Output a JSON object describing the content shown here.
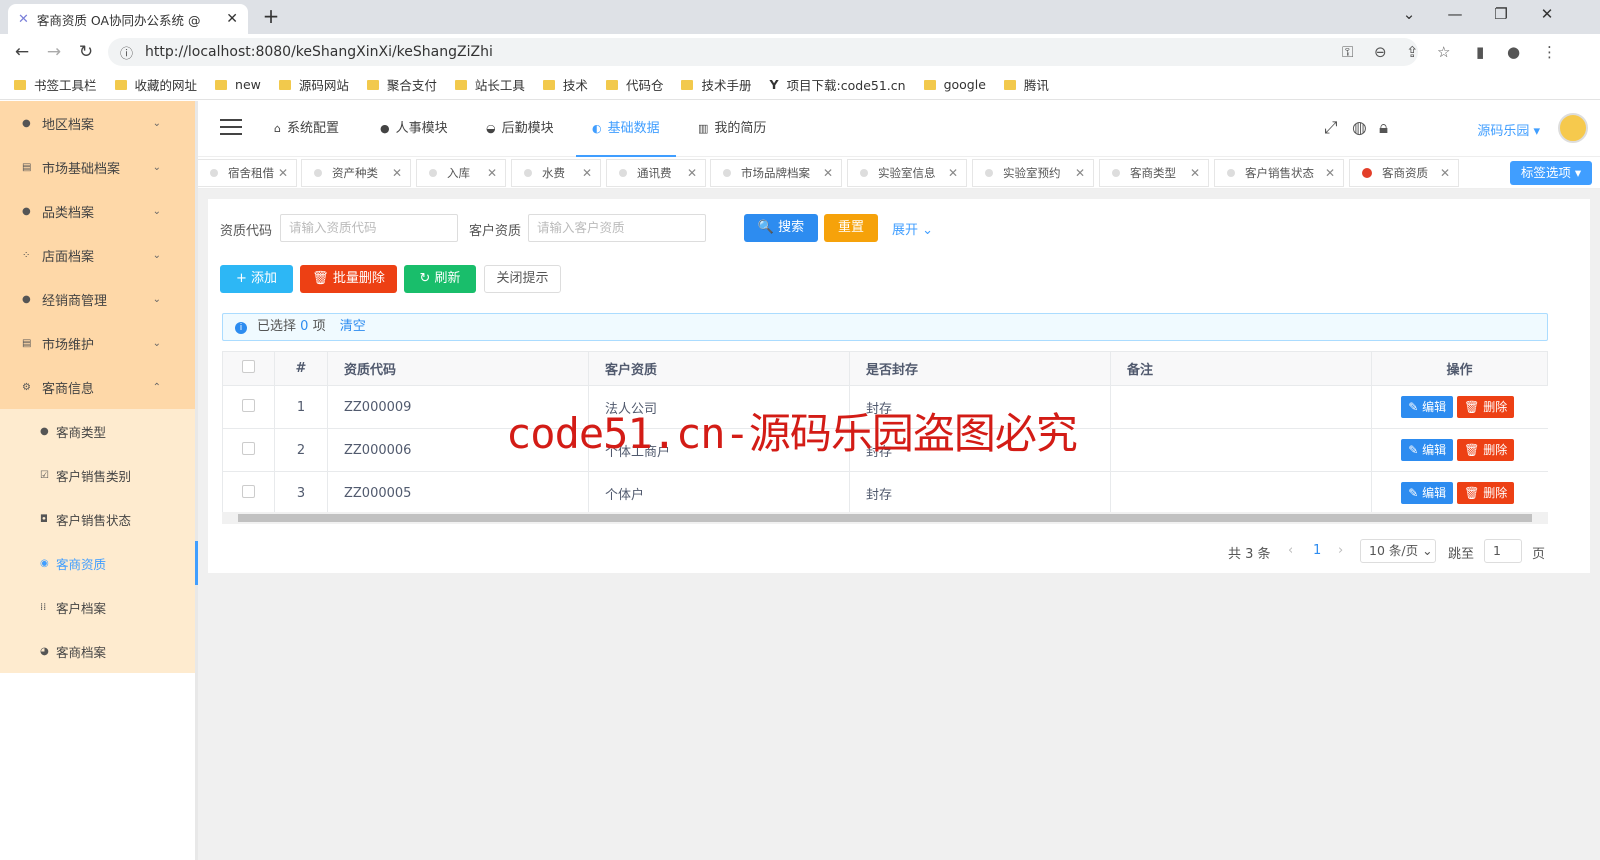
{
  "browser": {
    "tab_title": "客商资质 OA协同办公系统 @",
    "tab_close": "✕",
    "new_tab": "+",
    "url": "http://localhost:8080/keShangXinXi/keShangZiZhi",
    "bookmarks": [
      "书签工具栏",
      "收藏的网址",
      "new",
      "源码网站",
      "聚合支付",
      "站长工具",
      "技术",
      "代码仓",
      "技术手册",
      "项目下载:code51.cn",
      "google",
      "腾讯"
    ]
  },
  "sidebar": {
    "groups": [
      {
        "label": "地区档案",
        "icon": "circle-icon"
      },
      {
        "label": "市场基础档案",
        "icon": "table-icon"
      },
      {
        "label": "品类档案",
        "icon": "circle-icon"
      },
      {
        "label": "店面档案",
        "icon": "grid-icon"
      },
      {
        "label": "经销商管理",
        "icon": "circle-icon"
      },
      {
        "label": "市场维护",
        "icon": "table-icon"
      },
      {
        "label": "客商信息",
        "icon": "gear-icon"
      }
    ],
    "sub_items": [
      {
        "label": "客商类型"
      },
      {
        "label": "客户销售类别"
      },
      {
        "label": "客户销售状态"
      },
      {
        "label": "客商资质"
      },
      {
        "label": "客户档案"
      },
      {
        "label": "客商档案"
      }
    ]
  },
  "topnav": {
    "items": [
      "系统配置",
      "人事模块",
      "后勤模块",
      "基础数据",
      "我的简历"
    ],
    "active": "基础数据",
    "user": "源码乐园 ▾"
  },
  "page_tabs": [
    "宿舍租借",
    "资产种类",
    "入库",
    "水费",
    "通讯费",
    "市场品牌档案",
    "实验室信息",
    "实验室预约",
    "客商类型",
    "客户销售状态",
    "客商资质"
  ],
  "tag_options": "标签选项 ▾",
  "search": {
    "code_label": "资质代码",
    "code_placeholder": "请输入资质代码",
    "qual_label": "客户资质",
    "qual_placeholder": "请输入客户资质",
    "search_btn": "🔍 搜索",
    "reset_btn": "重置",
    "expand": "展开 ⌄"
  },
  "toolbar": {
    "add": "+ 添加",
    "batch_delete": "批量删除",
    "refresh": "刷新",
    "close_tip": "关闭提示"
  },
  "alert": {
    "prefix": "已选择",
    "count": "0",
    "suffix": "项",
    "clear": "清空"
  },
  "table": {
    "headers": [
      "#",
      "资质代码",
      "客户资质",
      "是否封存",
      "备注",
      "操作"
    ],
    "rows": [
      {
        "no": "1",
        "code": "ZZ000009",
        "qual": "法人公司",
        "sealed": "封存",
        "note": ""
      },
      {
        "no": "2",
        "code": "ZZ000006",
        "qual": "个体工商户",
        "sealed": "封存",
        "note": ""
      },
      {
        "no": "3",
        "code": "ZZ000005",
        "qual": "个体户",
        "sealed": "封存",
        "note": ""
      }
    ],
    "edit": "编辑",
    "delete": "删除"
  },
  "pagination": {
    "total": "共 3 条",
    "current": "1",
    "size": "10 条/页 ⌄",
    "jump": "跳至",
    "jump_val": "1",
    "page": "页"
  },
  "watermark": "code51.cn-源码乐园盗图必究"
}
